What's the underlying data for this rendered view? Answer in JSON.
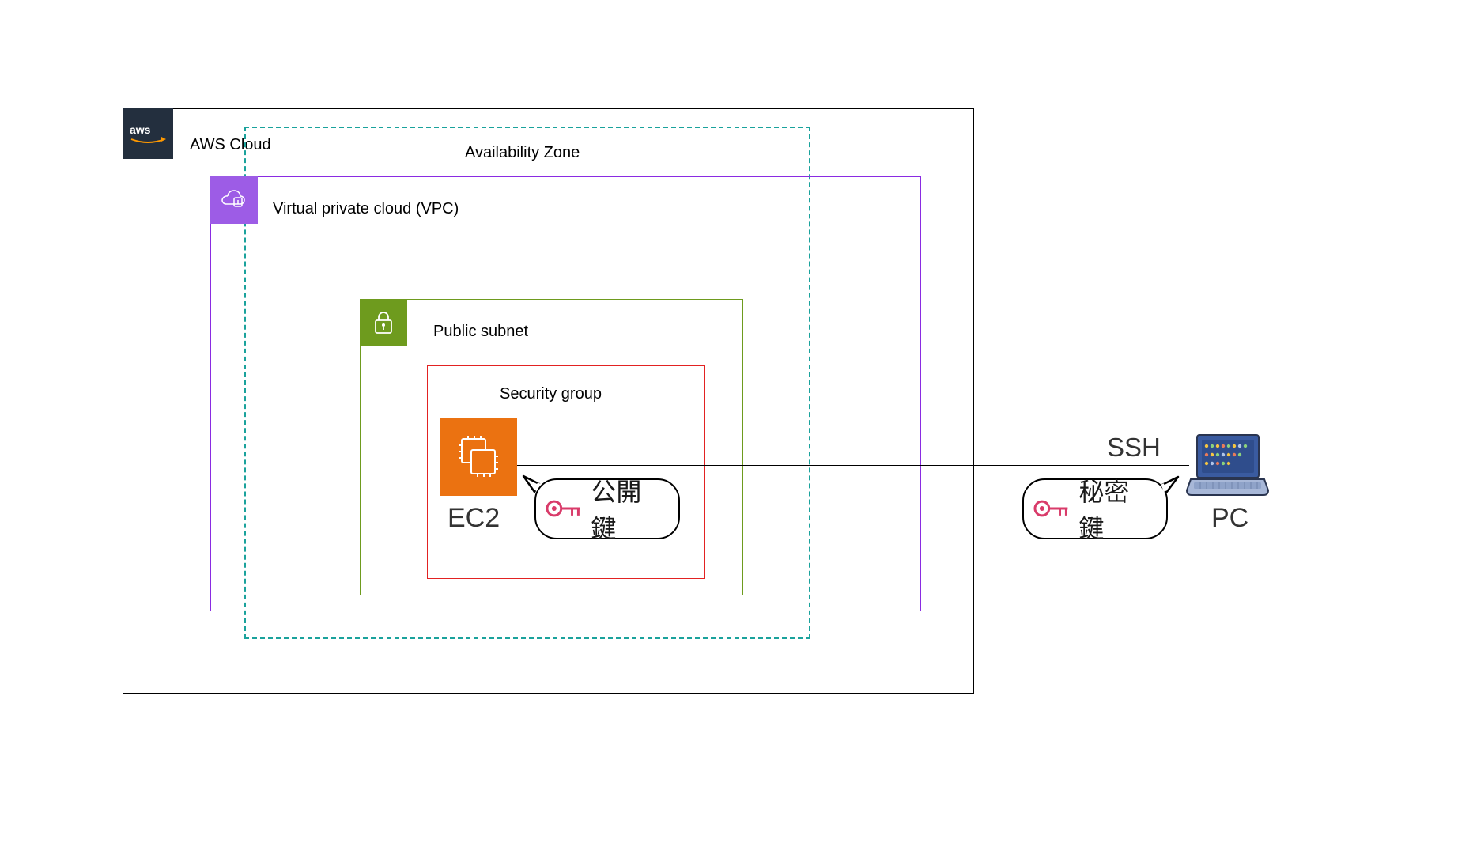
{
  "diagram": {
    "aws_cloud": {
      "label": "AWS Cloud"
    },
    "availability_zone": {
      "label": "Availability Zone"
    },
    "vpc": {
      "label": "Virtual private cloud (VPC)"
    },
    "public_subnet": {
      "label": "Public subnet"
    },
    "security_group": {
      "label": "Security group"
    },
    "ec2": {
      "label": "EC2"
    },
    "public_key": {
      "label": "公開鍵"
    },
    "private_key": {
      "label": "秘密鍵"
    },
    "ssh": {
      "label": "SSH"
    },
    "pc": {
      "label": "PC"
    }
  },
  "colors": {
    "aws_dark": "#232f3e",
    "az_teal": "#1aa29c",
    "vpc_purple": "#8a2be2",
    "subnet_green": "#6e9b1e",
    "sg_red": "#e22222",
    "ec2_orange": "#eb7211",
    "key_pink": "#d93b6a",
    "pc_blue": "#3a5ba0"
  }
}
